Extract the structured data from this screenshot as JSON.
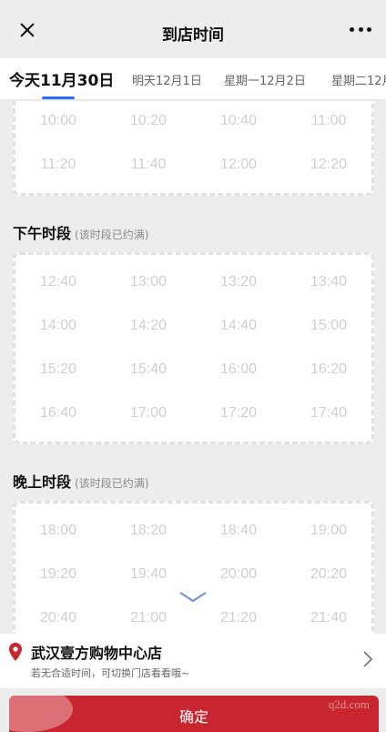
{
  "header": {
    "title": "到店时间"
  },
  "tabs": [
    {
      "label": "今天11月30日",
      "active": true
    },
    {
      "label": "明天12月1日",
      "active": false
    },
    {
      "label": "星期一12月2日",
      "active": false
    },
    {
      "label": "星期二12月",
      "active": false
    }
  ],
  "sections": [
    {
      "title": "",
      "note": "",
      "slots": [
        "10:00",
        "10:20",
        "10:40",
        "11:00",
        "11:20",
        "11:40",
        "12:00",
        "12:20"
      ]
    },
    {
      "title": "下午时段",
      "note": "(该时段已约满)",
      "slots": [
        "12:40",
        "13:00",
        "13:20",
        "13:40",
        "14:00",
        "14:20",
        "14:40",
        "15:00",
        "15:20",
        "15:40",
        "16:00",
        "16:20",
        "16:40",
        "17:00",
        "17:20",
        "17:40"
      ]
    },
    {
      "title": "晚上时段",
      "note": "(该时段已约满)",
      "slots": [
        "18:00",
        "18:20",
        "18:40",
        "19:00",
        "19:20",
        "19:40",
        "20:00",
        "20:20",
        "20:40",
        "21:00",
        "21:20",
        "21:40"
      ]
    }
  ],
  "store": {
    "name": "武汉壹方购物中心店",
    "tip": "若无合适时间，可切换门店看看哦~"
  },
  "confirm_label": "确定",
  "watermark": "q2d.com",
  "colors": {
    "accent": "#2b6cf5",
    "confirm": "#c8262e",
    "pin": "#c8262e"
  }
}
